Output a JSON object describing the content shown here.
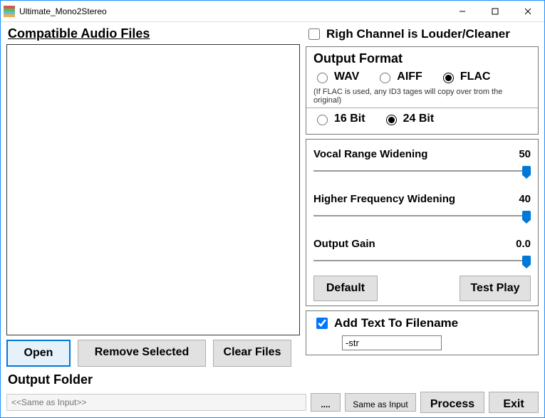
{
  "window": {
    "title": "Ultimate_Mono2Stereo"
  },
  "left": {
    "heading": "Compatible Audio Files",
    "buttons": {
      "open": "Open",
      "remove": "Remove Selected",
      "clear": "Clear Files"
    },
    "output_label": "Output Folder",
    "output_placeholder": "<<Same as Input>>"
  },
  "right": {
    "righ_channel_label": "Righ Channel is Louder/Cleaner",
    "output_format": {
      "title": "Output Format",
      "wav": "WAV",
      "aiff": "AIFF",
      "flac": "FLAC",
      "note": "(If FLAC is used, any ID3 tages will copy over trom the original)",
      "bit16": "16 Bit",
      "bit24": "24 Bit"
    },
    "sliders": {
      "vocal": {
        "label": "Vocal Range Widening",
        "value": "50"
      },
      "higher": {
        "label": "Higher Frequency Widening",
        "value": "40"
      },
      "gain": {
        "label": "Output Gain",
        "value": "0.0"
      }
    },
    "buttons": {
      "default": "Default",
      "testplay": "Test Play"
    },
    "addtext": {
      "label": "Add Text To Filename",
      "value": "-str"
    }
  },
  "footer": {
    "dots": "....",
    "sameas": "Same as Input",
    "process": "Process",
    "exit": "Exit"
  }
}
